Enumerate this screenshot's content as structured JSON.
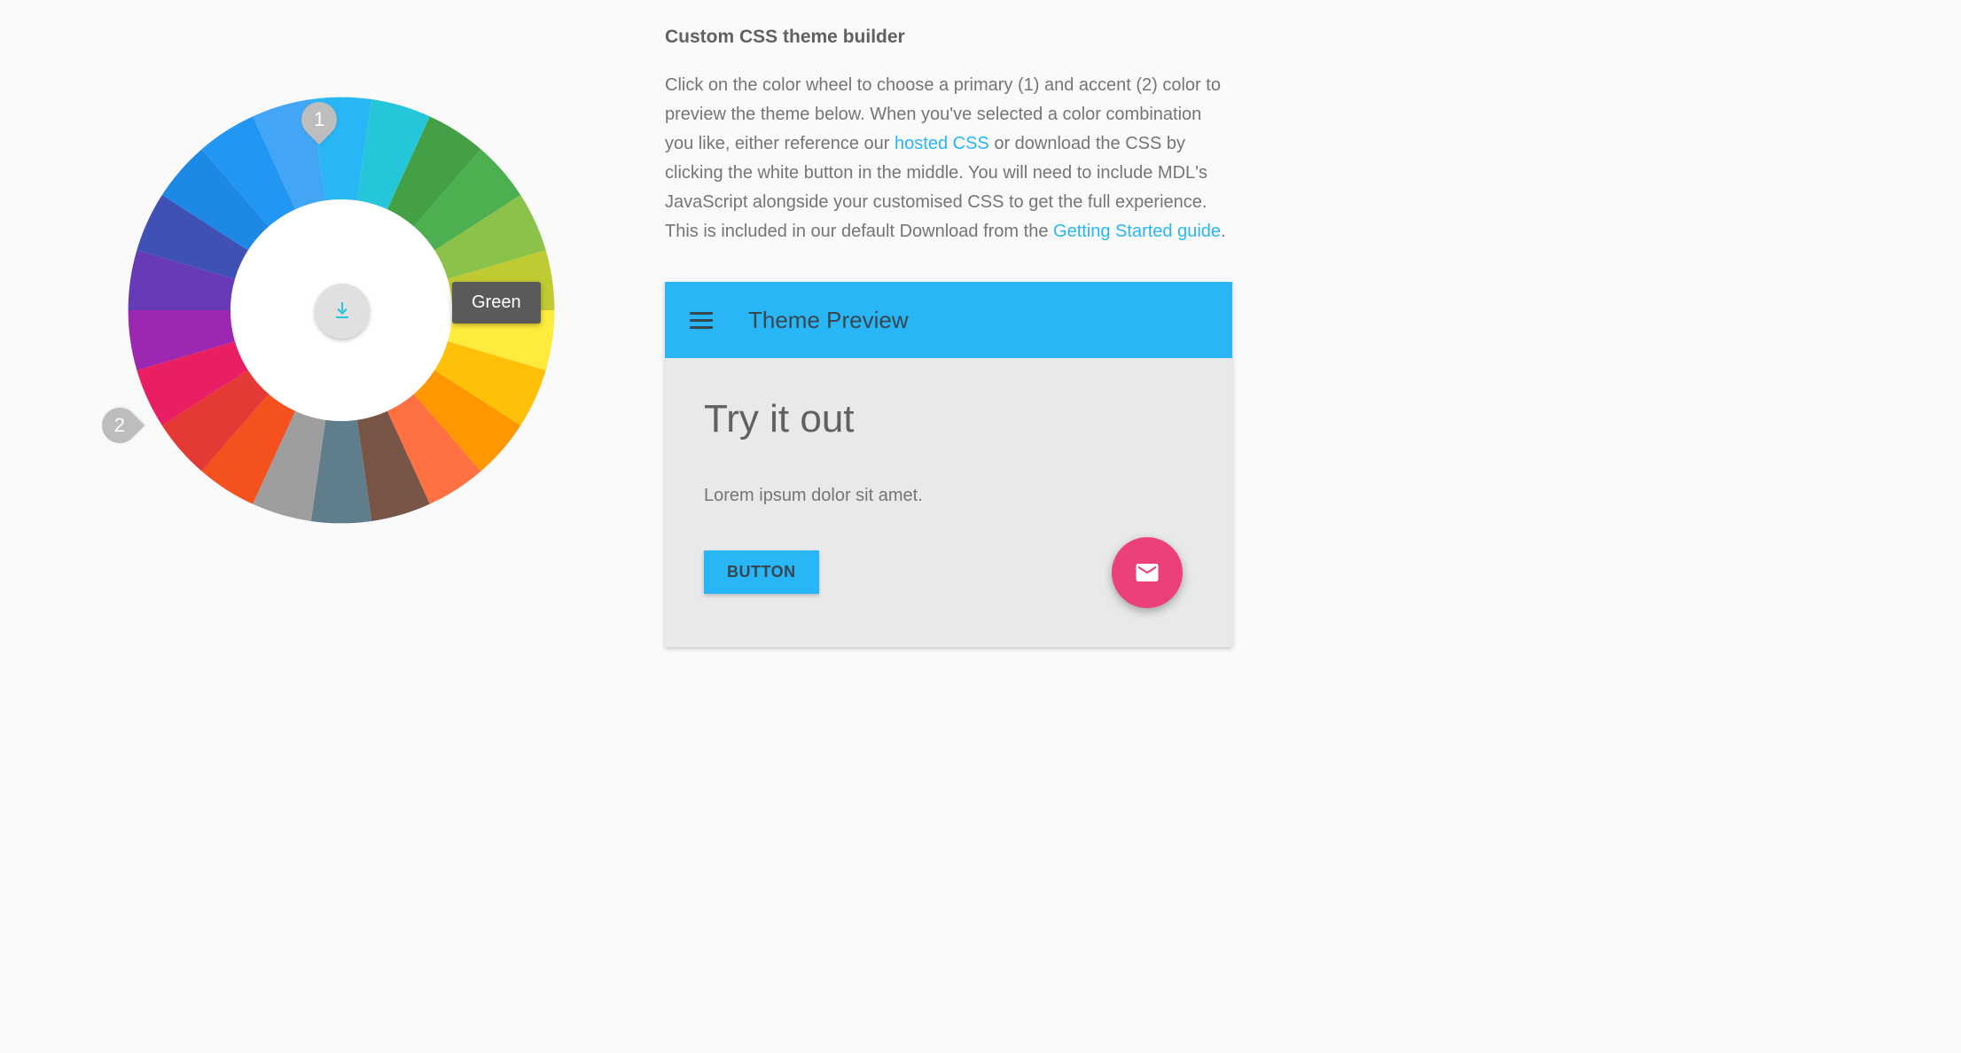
{
  "heading": "Custom CSS theme builder",
  "description": {
    "part1": "Click on the color wheel to choose a primary (1) and accent (2) color to preview the theme below. When you've selected a color combination you like, either reference our ",
    "link1": "hosted CSS",
    "part2": " or download the CSS by clicking the white button in the middle. You will need to include MDL's JavaScript alongside your customised CSS to get the full experience. This is included in our default Download from the ",
    "link2": "Getting Started guide",
    "part3": "."
  },
  "markers": {
    "primary": "1",
    "accent": "2"
  },
  "tooltip": "Green",
  "wheel_colors": [
    "#1e88e5",
    "#2196f3",
    "#42a5f5",
    "#29b6f6",
    "#26c6da",
    "#43a047",
    "#4caf50",
    "#8bc34a",
    "#c0ca33",
    "#ffeb3b",
    "#ffc107",
    "#ff9800",
    "#ff7043",
    "#795548",
    "#607d8b",
    "#9e9e9e",
    "#f4511e",
    "#e53935",
    "#e91e63",
    "#9c27b0",
    "#673ab7",
    "#3f51b5"
  ],
  "selected": {
    "primary_idx": 3,
    "accent_idx": 18
  },
  "preview": {
    "appbar_title": "Theme Preview",
    "heading": "Try it out",
    "body": "Lorem ipsum dolor sit amet.",
    "button": "BUTTON",
    "colors": {
      "primary": "#29b6f6",
      "accent": "#ec407a"
    }
  }
}
